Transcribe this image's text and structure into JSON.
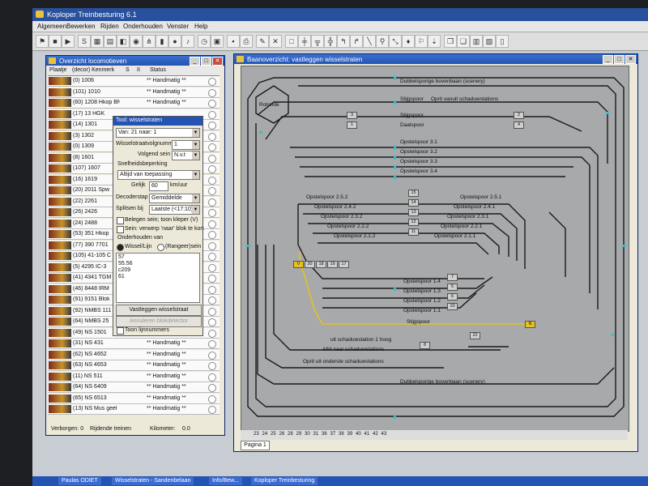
{
  "app": {
    "title": "Koploper Treinbesturing 6.1"
  },
  "menu": [
    "Algemeen",
    "Bewerken",
    "Rijden",
    "Onderhouden",
    "Venster",
    "Help"
  ],
  "loco_window": {
    "title": "Overzicht locomotieven",
    "columns": [
      "Plaatje",
      "(decor) Kenmerk",
      "S",
      "II",
      "Status"
    ],
    "rows": [
      {
        "name": "(0) 1006",
        "status": "** Handmatig **"
      },
      {
        "name": "(101) 1010",
        "status": "** Handmatig **"
      },
      {
        "name": "(60) 1208 Hkop BNL",
        "status": "** Handmatig **"
      },
      {
        "name": "(17) 13 HGK",
        "status": ""
      },
      {
        "name": "(14) 1301",
        "status": ""
      },
      {
        "name": "(3) 1302",
        "status": ""
      },
      {
        "name": "(0) 1309",
        "status": ""
      },
      {
        "name": "(8) 1601",
        "status": ""
      },
      {
        "name": "(107) 1607",
        "status": ""
      },
      {
        "name": "(16) 1619",
        "status": ""
      },
      {
        "name": "(20) 2011 Spw",
        "status": ""
      },
      {
        "name": "(22) 2261",
        "status": ""
      },
      {
        "name": "(26) 2426",
        "status": ""
      },
      {
        "name": "(24) 2488",
        "status": ""
      },
      {
        "name": "(53) 351 Hkop",
        "status": ""
      },
      {
        "name": "(77) 390 7701",
        "status": ""
      },
      {
        "name": "(105) 41-105 C",
        "status": ""
      },
      {
        "name": "(5) 4295 IC-3",
        "status": ""
      },
      {
        "name": "(41) 4341 TGM",
        "status": ""
      },
      {
        "name": "(46) 8448 IRM",
        "status": ""
      },
      {
        "name": "(91) 9151 Blok",
        "status": ""
      },
      {
        "name": "(92) NMBS 111",
        "status": ""
      },
      {
        "name": "(64) NMBS 25",
        "status": ""
      },
      {
        "name": "(49) NS 1501",
        "status": "** Handmatig **"
      },
      {
        "name": "(31) NS 431",
        "status": "** Handmatig **"
      },
      {
        "name": "(62) NS 4652",
        "status": "** Handmatig **"
      },
      {
        "name": "(63) NS 4653",
        "status": "** Handmatig **"
      },
      {
        "name": "(11) NS 511",
        "status": "** Handmatig **"
      },
      {
        "name": "(64) NS 6409",
        "status": "** Handmatig **"
      },
      {
        "name": "(65) NS 6513",
        "status": "** Handmatig **"
      },
      {
        "name": "(13) NS Mus geel",
        "status": "** Handmatig **"
      }
    ],
    "status_bar": {
      "verborgen": "Verborgen: 0",
      "rijdende": "Rijdende treinen",
      "kilometer_label": "Kilometer:",
      "kilometer_value": "0.0"
    }
  },
  "tool_panel": {
    "title": "Tool: wisselstraten",
    "route_select": "Van: 21 naar: 1",
    "volgnummer_label": "Wisselstraatvolgnummer",
    "volgnummer_value": "1",
    "volgend_sein_label": "Volgend sein",
    "volgend_sein_value": "N.v.t",
    "snelheid_group": "Snelheidsbeperking",
    "snelheid_value": "Altijd van toepassing",
    "gelijk_label": "Gelijk",
    "gelijk_value": "60",
    "gelijk_unit": "km/uur",
    "decoderstap_label": "Decoderstap",
    "decoderstap_value": "Gemiddelde",
    "splitsen_label": "Splitsen bij",
    "splitsen_value": "Laatste (<17:10)",
    "chk1": "Belegen sein; toon kleper (V)",
    "chk2": "Sein: verwerp 'naar' blok te kort",
    "onderhouden_group": "Onderhouden van",
    "radio1": "Wissel/Lijn",
    "radio2": "(Rangeer)sein",
    "text_lines": [
      "57",
      "55.56",
      "c209",
      "61"
    ],
    "btn_vastleggen": "Vastleggen wisselstraat",
    "btn_annuleren": "Annuleren blokdetector",
    "chk_toon": "Toon lijnnummers"
  },
  "track_window": {
    "title": "Baanoverzicht: vastleggen wisselstraten",
    "labels": {
      "dubbel_top": "Dubbelsporige bovenbaan (scenery)",
      "rotonde": "Rotonde",
      "stijgspoor_top": "Stijgspoor",
      "oprit": "Oprit vanuit schaduwstations",
      "stijgspoor2": "Stijgspoor",
      "daalspoor": "Daalspoor",
      "o31": "Opstelspoor 3.1",
      "o32": "Opstelspoor 3.2",
      "o33": "Opstelspoor 3.3",
      "o34": "Opstelspoor 3.4",
      "o252": "Opstelspoor 2.5.2",
      "o251": "Opstelspoor 2.5.1",
      "o242": "Opstelspoor 2.4.2",
      "o241": "Opstelspoor 2.4.1",
      "o232": "Opstelspoor 2.3.2",
      "o231": "Opstelspoor 2.3.1",
      "o222": "Opstelspoor 2.2.2",
      "o221": "Opstelspoor 2.2.1",
      "o212": "Opstelspoor 2.1.2",
      "o211": "Opstelspoor 2.1.1",
      "o14": "Opstelspoor 1.4",
      "o13": "Opstelspoor 1.3",
      "o12": "Opstelspoor 1.2",
      "o11": "Opstelspoor 1.1",
      "stijgspoor_bottom": "Stijgspoor",
      "schaduw1": "uit schaduwstation 1 hoog",
      "afrit": "Afrit naar schaduwstations",
      "oprit_onder": "Oprit uit onderste schaduwstations",
      "dubbel_bottom": "Dubbelsporige bovenbaan (scenery)"
    },
    "blocks": [
      "3",
      "1",
      "2",
      "4",
      "15",
      "14",
      "13",
      "12",
      "11",
      "V",
      "20",
      "18",
      "19",
      "17",
      "7",
      "5",
      "6",
      "10",
      "N",
      "22",
      "8"
    ],
    "page_numbers": [
      "23",
      "24",
      "25",
      "26",
      "28",
      "29",
      "30",
      "31",
      "36",
      "37",
      "38",
      "39",
      "40",
      "41",
      "42",
      "43"
    ],
    "tab": "Pagina 1"
  },
  "taskbar": [
    "Paulas ODIET",
    "Wisselstraten - Sandenbelaan",
    "Info/Bew...",
    "Koploper Treinbesturing"
  ],
  "colors": {
    "track": "#1a1a1a",
    "active_route": "#e6c21e",
    "sensor": "#39bfc7",
    "canvas": "#a7a9ab"
  }
}
